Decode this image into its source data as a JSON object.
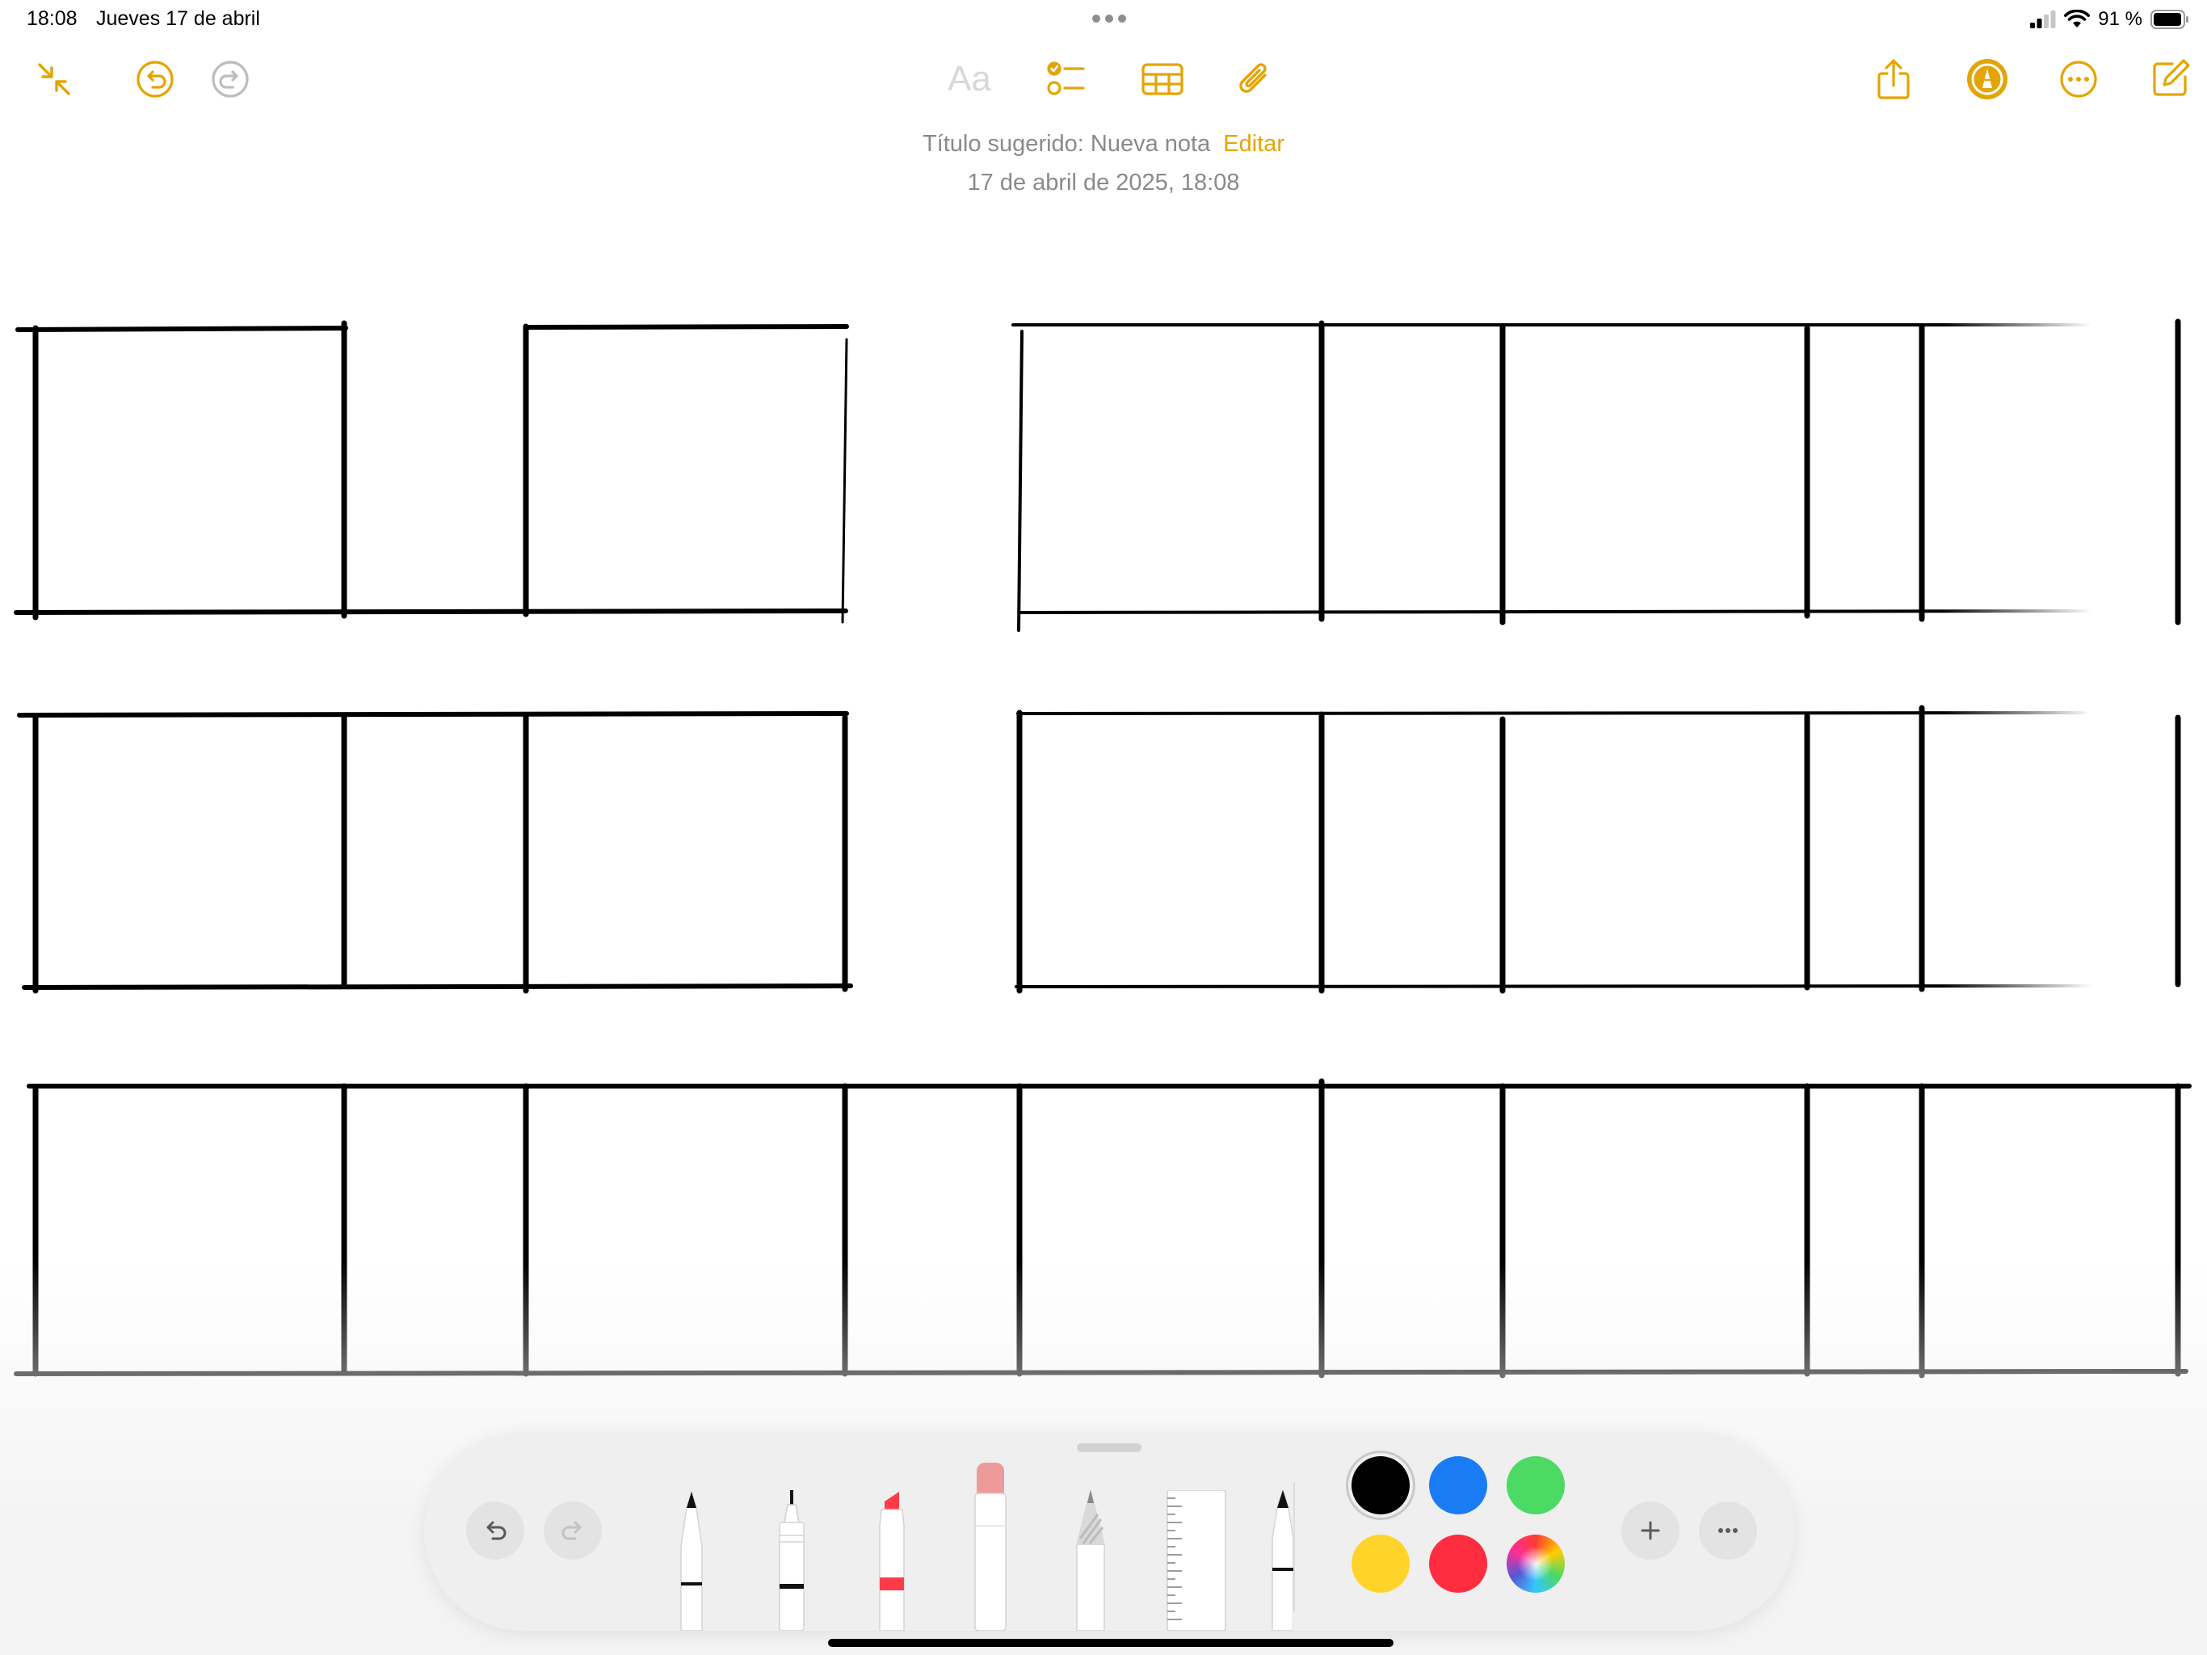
{
  "status_bar": {
    "time": "18:08",
    "date": "Jueves 17 de abril",
    "battery": "91 %"
  },
  "toolbar": {
    "left_icons": [
      "collapse-icon",
      "undo-icon",
      "redo-icon"
    ],
    "format_label": "Aa",
    "center_icons": [
      "checklist-icon",
      "table-icon",
      "attachment-icon"
    ],
    "right_icons": [
      "share-icon",
      "markup-icon",
      "more-icon",
      "compose-icon"
    ]
  },
  "note": {
    "suggested_title": "Título sugerido: Nueva nota",
    "edit_label": "Editar",
    "timestamp": "17 de abril de 2025, 18:08"
  },
  "markup_palette": {
    "tools": [
      "pen",
      "fineliner",
      "marker",
      "eraser",
      "pencil",
      "ruler",
      "fountain-pen"
    ],
    "colors": [
      "#000000",
      "#1a7cf5",
      "#4cd964",
      "#ffd42a",
      "#ff2d3f",
      "color-wheel"
    ]
  },
  "colors": {
    "accent": "#e3a505",
    "ink": "#000000"
  }
}
